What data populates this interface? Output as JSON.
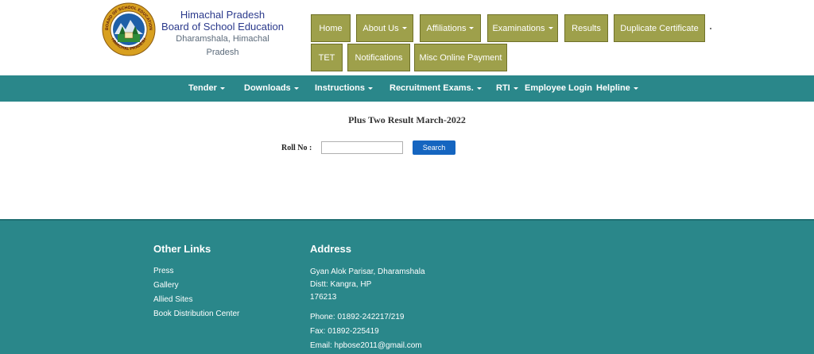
{
  "brand": {
    "line1": "Himachal Pradesh",
    "line2": "Board of School Education",
    "line3": "Dharamshala, Himachal Pradesh"
  },
  "logo": {
    "icon": "hpbose-emblem-icon",
    "ring_top_text": "BOARD OF SCHOOL EDUCATION",
    "ring_bottom_text": "HIMACHAL PRADESH",
    "ring_color": "#d8a020",
    "inner_color": "#1f5fa8"
  },
  "topnav": {
    "home": "Home",
    "about": "About Us",
    "affiliations": "Affiliations",
    "examinations": "Examinations",
    "results": "Results",
    "duplicate": "Duplicate Certificate",
    "tet": "TET",
    "notifications": "Notifications",
    "misc": "Misc Online Payment"
  },
  "menubar": {
    "tender": "Tender",
    "downloads": "Downloads",
    "instructions": "Instructions",
    "recruitment": "Recruitment Exams.",
    "rti": "RTI",
    "employee": "Employee Login",
    "helpline": "Helpline"
  },
  "main": {
    "title": "Plus Two Result March-2022",
    "roll_label": "Roll No :",
    "roll_value": "",
    "search_label": "Search"
  },
  "footer": {
    "links_title": "Other Links",
    "links": [
      "Press",
      "Gallery",
      "Allied Sites",
      "Book Distribution Center"
    ],
    "address_title": "Address",
    "address": [
      "Gyan Alok Parisar, Dharamshala",
      "Distt: Kangra, HP",
      "176213"
    ],
    "phone": "Phone: 01892-242217/219",
    "fax": "Fax: 01892-225419",
    "email": "Email: hpbose2011@gmail.com"
  },
  "colors": {
    "nav_button": "#9ea04b",
    "teal": "#2a878a",
    "search_button": "#1565c0",
    "brand_text": "#2b3a8c"
  }
}
